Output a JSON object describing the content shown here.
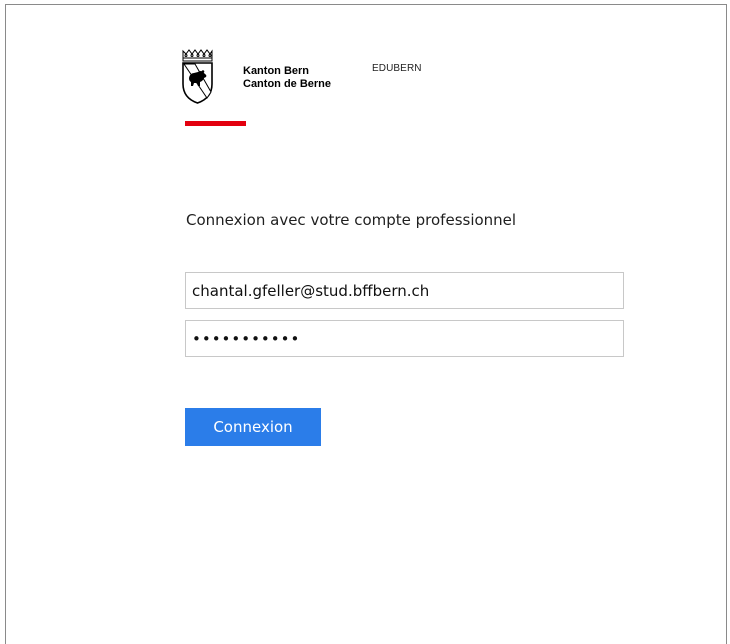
{
  "header": {
    "logo_icon": "bern-coat-of-arms-icon",
    "org_name_line1": "Kanton Bern",
    "org_name_line2": "Canton de Berne",
    "app_name": "EDUBERN",
    "accent_color": "#e3000f"
  },
  "login": {
    "heading": "Connexion avec votre compte professionnel",
    "email_value": "chantal.gfeller@stud.bffbern.ch",
    "password_value": "•••••••••••",
    "submit_label": "Connexion",
    "submit_color": "#2b7de9"
  }
}
